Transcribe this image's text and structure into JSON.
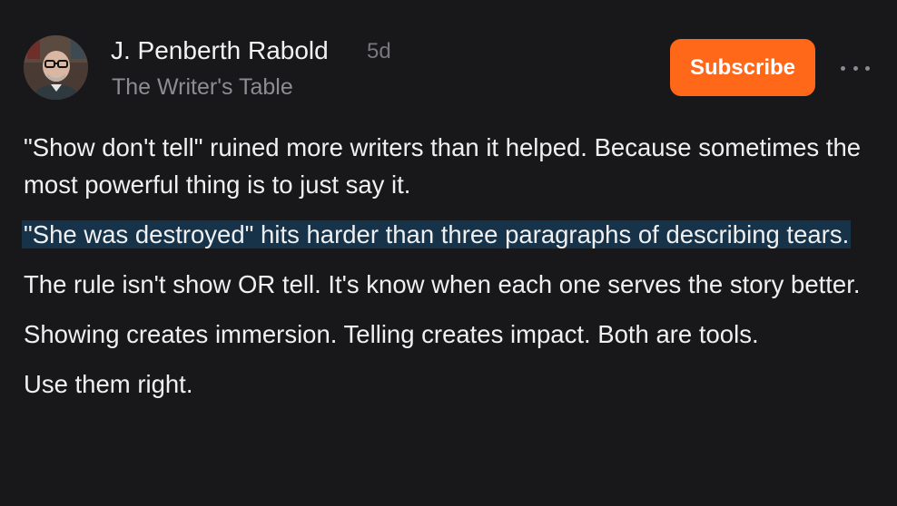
{
  "post": {
    "author": {
      "name": "J. Penberth Rabold",
      "age": "5d",
      "publication": "The Writer's Table"
    },
    "actions": {
      "subscribe_label": "Subscribe",
      "more_icon": "more-horizontal-icon"
    },
    "paragraphs": [
      "\"Show don't tell\" ruined more writers than it helped. Because sometimes the most powerful thing is to just say it.",
      "\"She was destroyed\" hits harder than three paragraphs of describing tears.",
      "The rule isn't show OR tell. It's know when each one serves the story better.",
      "Showing creates immersion. Telling creates impact. Both are tools.",
      "Use them right."
    ],
    "highlighted_paragraph_index": 1
  },
  "colors": {
    "background": "#18181b",
    "subscribe_button": "#ff6719",
    "highlight": "#16334a",
    "muted_text": "#8c8c91"
  }
}
